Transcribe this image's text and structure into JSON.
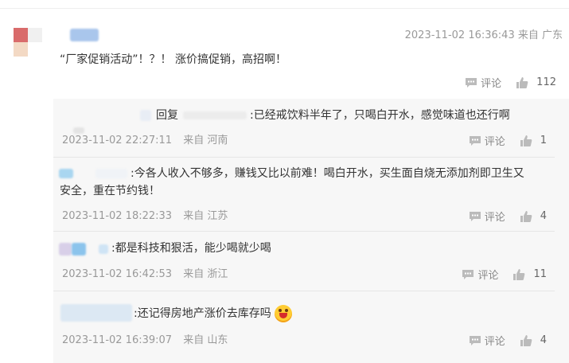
{
  "main_comment": {
    "timestamp": "2023-11-02 16:36:43",
    "location": "来自 广东",
    "text": "“厂家促销活动”！？！ 涨价搞促销，高招啊！",
    "comment_label": "评论",
    "like_count": "112"
  },
  "replies": [
    {
      "reply_word": "回复",
      "text": ":已经戒饮料半年了，只喝白开水，感觉味道也还行啊",
      "timestamp": "2023-11-02 22:27:11",
      "location": "来自 河南",
      "comment_label": "评论",
      "like_count": "1"
    },
    {
      "text_line1": ":今各人收入不够多，赚钱又比以前难！喝白开水，买生面自烧无添加剂即卫生又",
      "text_line2": "安全，重在节约钱！",
      "timestamp": "2023-11-02 18:22:33",
      "location": "来自 江苏",
      "comment_label": "评论",
      "like_count": "4"
    },
    {
      "text": ":都是科技和狠活，能少喝就少喝",
      "timestamp": "2023-11-02 16:42:53",
      "location": "来自 浙江",
      "comment_label": "评论",
      "like_count": "11"
    },
    {
      "text": ":还记得房地产涨价去库存吗",
      "emoji": "grinning-face-emoji",
      "timestamp": "2023-11-02 16:39:07",
      "location": "来自 山东",
      "comment_label": "评论",
      "like_count": "4"
    }
  ],
  "icons": {
    "comment": "comment-icon",
    "like": "thumbs-up-icon"
  }
}
